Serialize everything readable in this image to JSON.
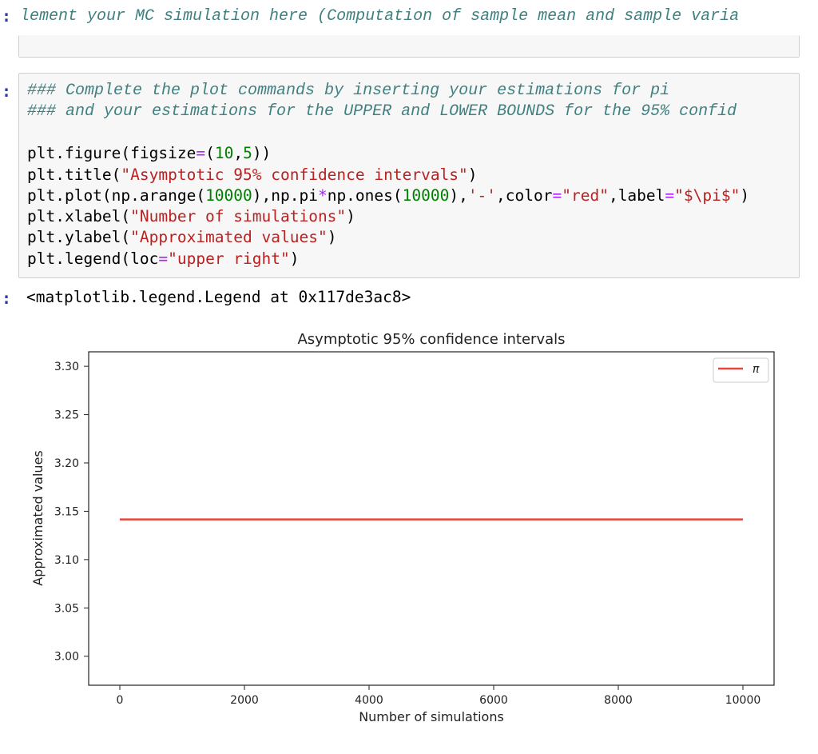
{
  "cell1": {
    "prompt": ":",
    "comment": "lement your MC simulation here (Computation of sample mean and sample varia"
  },
  "cell2": {
    "prompt": ":",
    "lines": [
      "### Complete the plot commands by inserting your estimations for pi",
      "### and your estimations for the UPPER and LOWER BOUNDS for the 95% confid"
    ]
  },
  "output": {
    "prompt": ":",
    "text": "<matplotlib.legend.Legend at 0x117de3ac8>"
  },
  "chart_data": {
    "type": "line",
    "title": "Asymptotic 95% confidence intervals",
    "xlabel": "Number of simulations",
    "ylabel": "Approximated values",
    "xlim": [
      -500,
      10500
    ],
    "ylim": [
      2.97,
      3.315
    ],
    "xticks": [
      0,
      2000,
      4000,
      6000,
      8000,
      10000
    ],
    "xtick_labels": [
      "0",
      "2000",
      "4000",
      "6000",
      "8000",
      "10000"
    ],
    "yticks": [
      3.0,
      3.05,
      3.1,
      3.15,
      3.2,
      3.25,
      3.3
    ],
    "ytick_labels": [
      "3.00",
      "3.05",
      "3.10",
      "3.15",
      "3.20",
      "3.25",
      "3.30"
    ],
    "legend_loc": "upper right",
    "grid": false,
    "series": [
      {
        "name": "π",
        "color": "#e8463a",
        "x": [
          0,
          10000
        ],
        "y": [
          3.14159,
          3.14159
        ]
      }
    ]
  }
}
